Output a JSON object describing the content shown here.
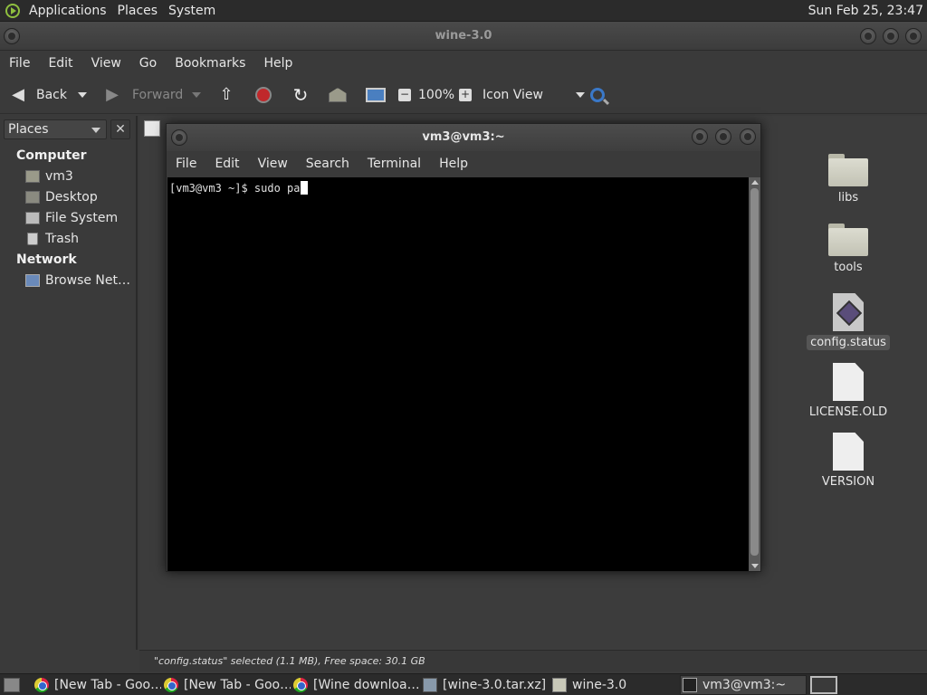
{
  "top_panel": {
    "menus": [
      "Applications",
      "Places",
      "System"
    ],
    "clock": "Sun Feb 25, 23:47"
  },
  "file_manager": {
    "title": "wine-3.0",
    "menus": [
      "File",
      "Edit",
      "View",
      "Go",
      "Bookmarks",
      "Help"
    ],
    "toolbar": {
      "back": "Back",
      "forward": "Forward",
      "zoom": "100%",
      "view_mode": "Icon View"
    },
    "sidebar": {
      "header": "Places",
      "close": "✕",
      "sections": [
        {
          "title": "Computer",
          "items": [
            "vm3",
            "Desktop",
            "File System",
            "Trash"
          ]
        },
        {
          "title": "Network",
          "items": [
            "Browse Net…"
          ]
        }
      ]
    },
    "files": [
      {
        "name": "libs",
        "type": "folder"
      },
      {
        "name": "tools",
        "type": "folder"
      },
      {
        "name": "config.status",
        "type": "script",
        "selected": true
      },
      {
        "name": "LICENSE.OLD",
        "type": "doc"
      },
      {
        "name": "VERSION",
        "type": "doc"
      }
    ],
    "status": "\"config.status\" selected (1.1 MB), Free space: 30.1 GB"
  },
  "terminal": {
    "title": "vm3@vm3:~",
    "menus": [
      "File",
      "Edit",
      "View",
      "Search",
      "Terminal",
      "Help"
    ],
    "prompt": "[vm3@vm3 ~]$ ",
    "command": "sudo pa"
  },
  "taskbar": {
    "tasks": [
      {
        "label": "[New Tab - Goo…",
        "icon": "chrome-icon"
      },
      {
        "label": "[New Tab - Goo…",
        "icon": "chrome-icon"
      },
      {
        "label": "[Wine downloa…",
        "icon": "chrome-icon"
      },
      {
        "label": "[wine-3.0.tar.xz]",
        "icon": "archive-icon"
      },
      {
        "label": "wine-3.0",
        "icon": "folder-icon"
      },
      {
        "label": "vm3@vm3:~",
        "icon": "terminal-icon",
        "active": true
      }
    ]
  }
}
